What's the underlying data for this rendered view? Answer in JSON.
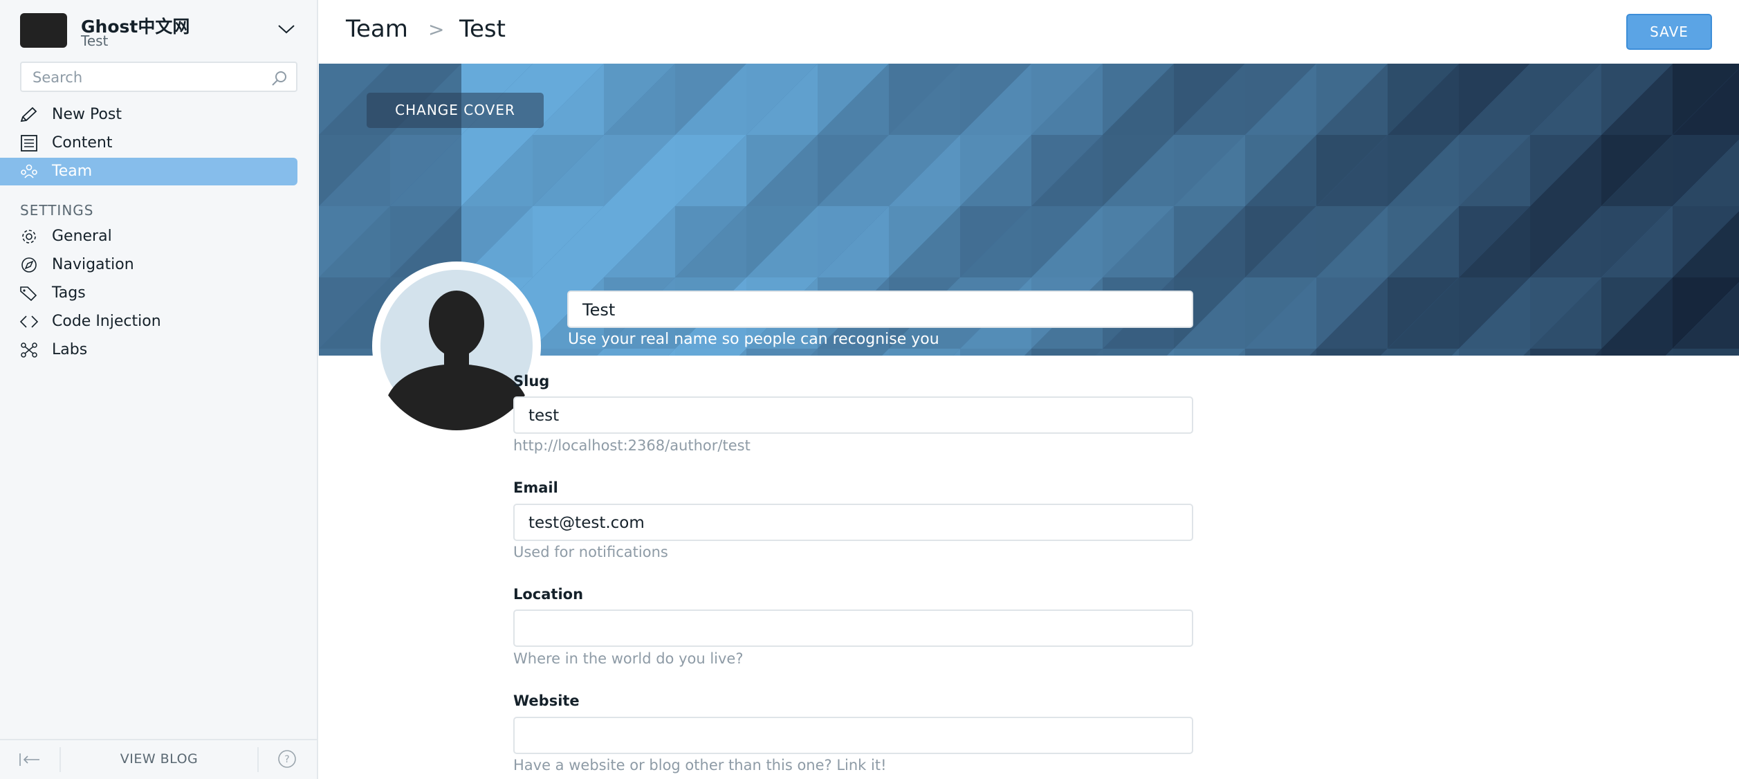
{
  "blog": {
    "name": "Ghost中文网",
    "user": "Test"
  },
  "search": {
    "placeholder": "Search"
  },
  "nav": {
    "main": [
      {
        "label": "New Post",
        "icon": "pen-icon"
      },
      {
        "label": "Content",
        "icon": "content-icon"
      },
      {
        "label": "Team",
        "icon": "team-icon",
        "active": true
      }
    ],
    "settings_heading": "SETTINGS",
    "settings": [
      {
        "label": "General",
        "icon": "gear-icon"
      },
      {
        "label": "Navigation",
        "icon": "compass-icon"
      },
      {
        "label": "Tags",
        "icon": "tag-icon"
      },
      {
        "label": "Code Injection",
        "icon": "code-icon"
      },
      {
        "label": "Labs",
        "icon": "labs-icon"
      }
    ]
  },
  "footer": {
    "view_blog": "VIEW BLOG"
  },
  "breadcrumb": {
    "parent": "Team",
    "separator": ">",
    "current": "Test"
  },
  "toolbar": {
    "save_label": "SAVE"
  },
  "cover": {
    "change_label": "CHANGE COVER"
  },
  "profile": {
    "name_value": "Test",
    "name_hint": "Use your real name so people can recognise you",
    "fields": [
      {
        "label": "Slug",
        "value": "test",
        "hint": "http://localhost:2368/author/test"
      },
      {
        "label": "Email",
        "value": "test@test.com",
        "hint": "Used for notifications"
      },
      {
        "label": "Location",
        "value": "",
        "hint": "Where in the world do you live?"
      },
      {
        "label": "Website",
        "value": "",
        "hint": "Have a website or blog other than this one? Link it!"
      }
    ]
  },
  "colors": {
    "accent": "#5ba4e5",
    "active_nav": "#86bdeb",
    "sidebar_bg": "#f5f7f9"
  }
}
